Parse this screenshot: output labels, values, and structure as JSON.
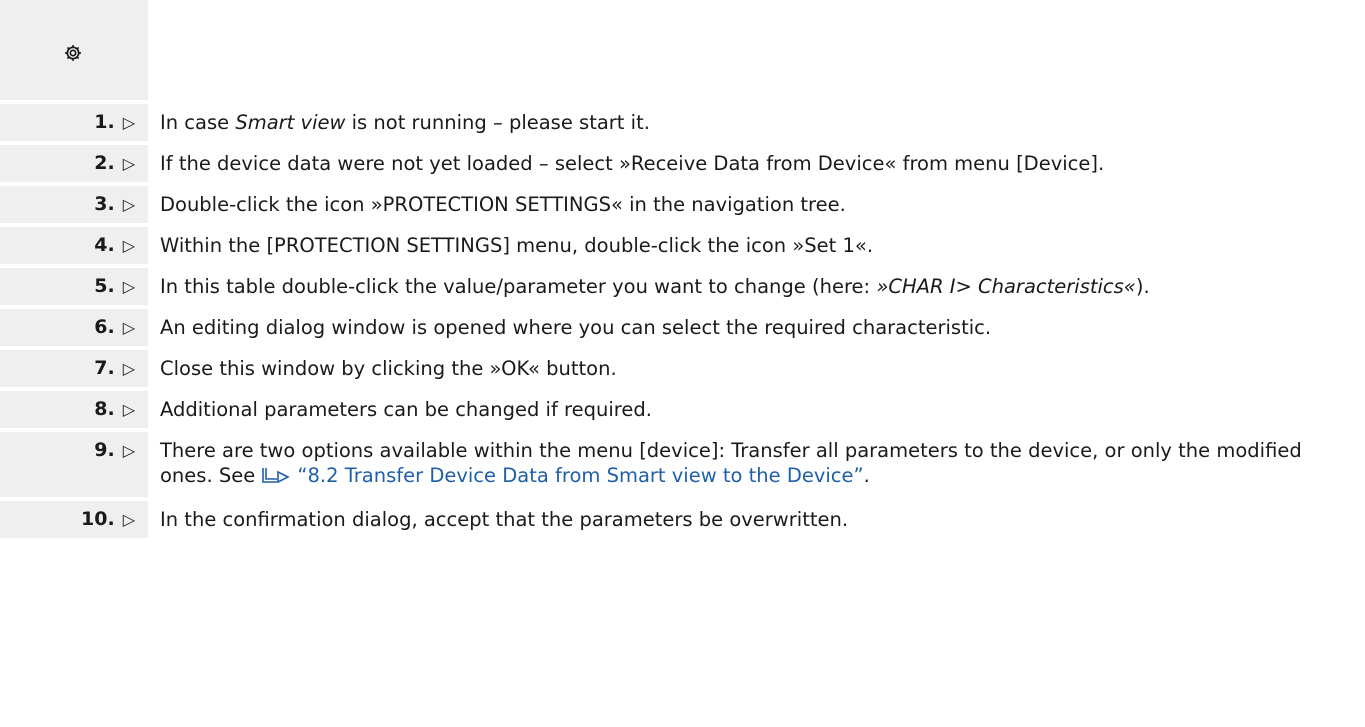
{
  "header": {
    "icon": "gear-icon"
  },
  "steps": [
    {
      "number": "1.",
      "arrow": "▷",
      "text_before": "In case ",
      "text_italic": "Smart view",
      "text_after": " is not running – please start it."
    },
    {
      "number": "2.",
      "arrow": "▷",
      "text": "If the device data were not yet loaded – select »Receive Data from Device« from menu [Device]."
    },
    {
      "number": "3.",
      "arrow": "▷",
      "text": "Double-click the icon »PROTECTION SETTINGS« in the navigation tree."
    },
    {
      "number": "4.",
      "arrow": "▷",
      "text": "Within the [PROTECTION SETTINGS] menu, double-click the icon »Set 1«."
    },
    {
      "number": "5.",
      "arrow": "▷",
      "text_before": "In this table double-click the value/parameter you want to change (here: ",
      "text_italic": "»CHAR I> Characteristics«",
      "text_after": ")."
    },
    {
      "number": "6.",
      "arrow": "▷",
      "text": "An editing dialog window is opened where you can select the required characteristic."
    },
    {
      "number": "7.",
      "arrow": "▷",
      "text": "Close this window by clicking the »OK« button."
    },
    {
      "number": "8.",
      "arrow": "▷",
      "text": "Additional parameters can be changed if required."
    },
    {
      "number": "9.",
      "arrow": "▷",
      "text_before": "There are two options available within the menu [device]: Transfer all parameters to the device, or only the modified ones. See ",
      "link_icon": "cross-reference-arrow-icon",
      "link_text": "“8.2 Transfer Device Data from Smart view to the Device”",
      "text_after": "."
    },
    {
      "number": "10.",
      "arrow": "▷",
      "text": "In the confirmation dialog, accept that the parameters be overwritten."
    }
  ],
  "colors": {
    "number_cell_background": "#efefef",
    "link": "#1f5fa8",
    "text": "#1a1a1a"
  }
}
